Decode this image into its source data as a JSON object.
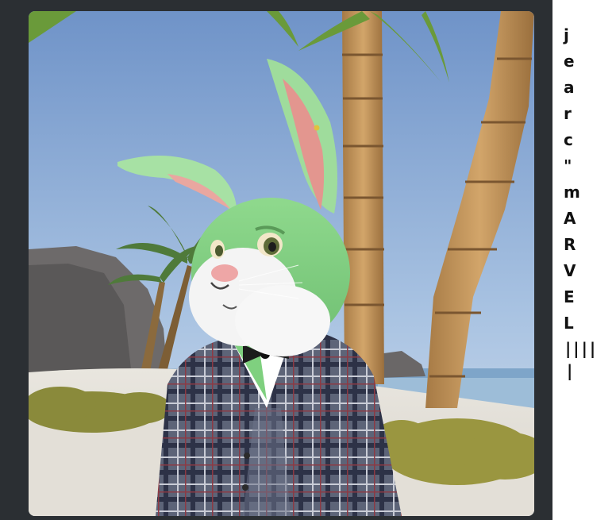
{
  "side_text": {
    "lines": [
      "j",
      "e",
      "a",
      "r",
      "c",
      "\"",
      "m",
      "A",
      "R",
      "V",
      "E",
      "L",
      "||||",
      "|"
    ]
  },
  "image": {
    "subject": "green-rabbit-character",
    "scene": "tropical-beach"
  },
  "colors": {
    "panel_background": "#2b2f33",
    "page_background": "#ffffff",
    "text": "#111111"
  }
}
